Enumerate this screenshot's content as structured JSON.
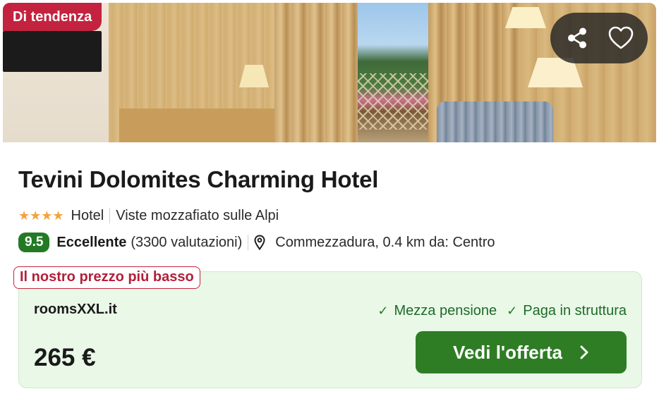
{
  "photo": {
    "trend_badge": "Di tendenza",
    "share_icon": "share-icon",
    "favorite_icon": "heart-icon"
  },
  "hotel": {
    "name": "Tevini Dolomites Charming Hotel",
    "stars": 4,
    "stars_display": "★★★★",
    "type": "Hotel",
    "tagline": "Viste mozzafiato sulle Alpi",
    "score": "9.5",
    "rating_label": "Eccellente",
    "reviews": "(3300 valutazioni)",
    "location": "Commezzadura, 0.4 km da: Centro"
  },
  "offer": {
    "lowest_price_tag": "Il nostro prezzo più basso",
    "provider": "roomsXXL.it",
    "features": [
      "Mezza pensione",
      "Paga in struttura"
    ],
    "price": "265 €",
    "cta_label": "Vedi l'offerta"
  },
  "colors": {
    "badge_red": "#c3233f",
    "score_green": "#237a25",
    "cta_green": "#2e7d24",
    "offer_bg": "#e9f8e7",
    "star_orange": "#f4a23a"
  }
}
